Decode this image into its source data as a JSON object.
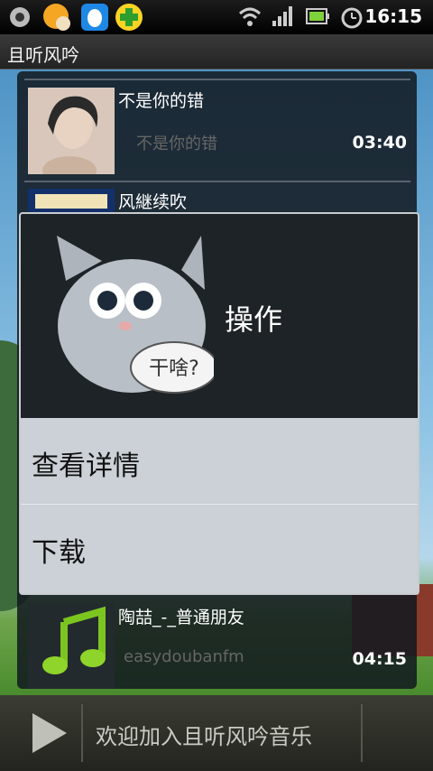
{
  "status_bar": {
    "time": "16:15",
    "icons": [
      "settings-icon",
      "qq-avatar-icon",
      "qq-penguin-icon",
      "qq-manager-icon",
      "wifi-icon",
      "signal-icon",
      "battery-icon",
      "alarm-icon"
    ]
  },
  "app": {
    "title": "且听风吟"
  },
  "tracks": [
    {
      "title": "不是你的错",
      "subtitle": "不是你的错",
      "duration": "03:40"
    },
    {
      "title": "风継续吹",
      "subtitle": "",
      "duration": ""
    },
    {
      "title": "陶喆_-_普通朋友",
      "subtitle": "easydoubanfm",
      "duration": "04:15"
    }
  ],
  "dialog": {
    "title": "操作",
    "mascot_text": "干啥?",
    "items": [
      "查看详情",
      "下载"
    ]
  },
  "player": {
    "message": "欢迎加入且听风吟音乐"
  },
  "colors": {
    "dialog_header": "#1e2327",
    "dialog_body": "#cbd1d6",
    "accent_green": "#6dbb1f"
  }
}
